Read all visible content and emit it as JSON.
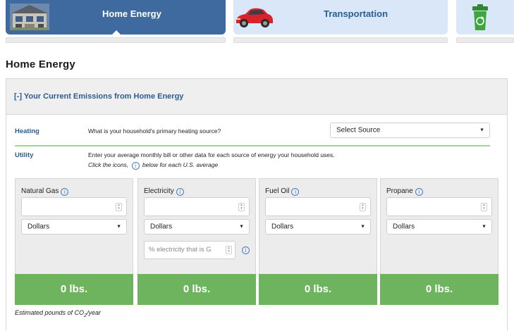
{
  "tabs": [
    {
      "label": "Home Energy",
      "icon": "house-icon",
      "active": true
    },
    {
      "label": "Transportation",
      "icon": "car-icon",
      "active": false
    },
    {
      "label": "",
      "icon": "recycle-bin-icon",
      "active": false
    }
  ],
  "page_title": "Home Energy",
  "panel": {
    "header": "[-] Your Current Emissions from Home Energy",
    "heating": {
      "label": "Heating",
      "question": "What is your household's primary heating source?",
      "select_value": "Select Source"
    },
    "utility": {
      "label": "Utility",
      "instruction": "Enter your average monthly bill or other data for each source of energy your household uses.",
      "hint_before": "Click the icons,",
      "hint_after": "below for each U.S. average"
    },
    "sources": [
      {
        "name": "Natural Gas",
        "unit": "Dollars",
        "value": "",
        "result": "0 lbs."
      },
      {
        "name": "Electricity",
        "unit": "Dollars",
        "value": "",
        "result": "0 lbs.",
        "green_percent_placeholder": "% electricity that is G"
      },
      {
        "name": "Fuel Oil",
        "unit": "Dollars",
        "value": "",
        "result": "0 lbs."
      },
      {
        "name": "Propane",
        "unit": "Dollars",
        "value": "",
        "result": "0 lbs."
      }
    ],
    "footnote": "Estimated pounds of CO",
    "footnote_sub": "2",
    "footnote_end": "/year"
  },
  "colors": {
    "active_tab": "#3e6aa0",
    "inactive_tab": "#d9e7f8",
    "link_blue": "#2b5d93",
    "result_green": "#6eb45f",
    "divider_green": "#9fd68f"
  }
}
